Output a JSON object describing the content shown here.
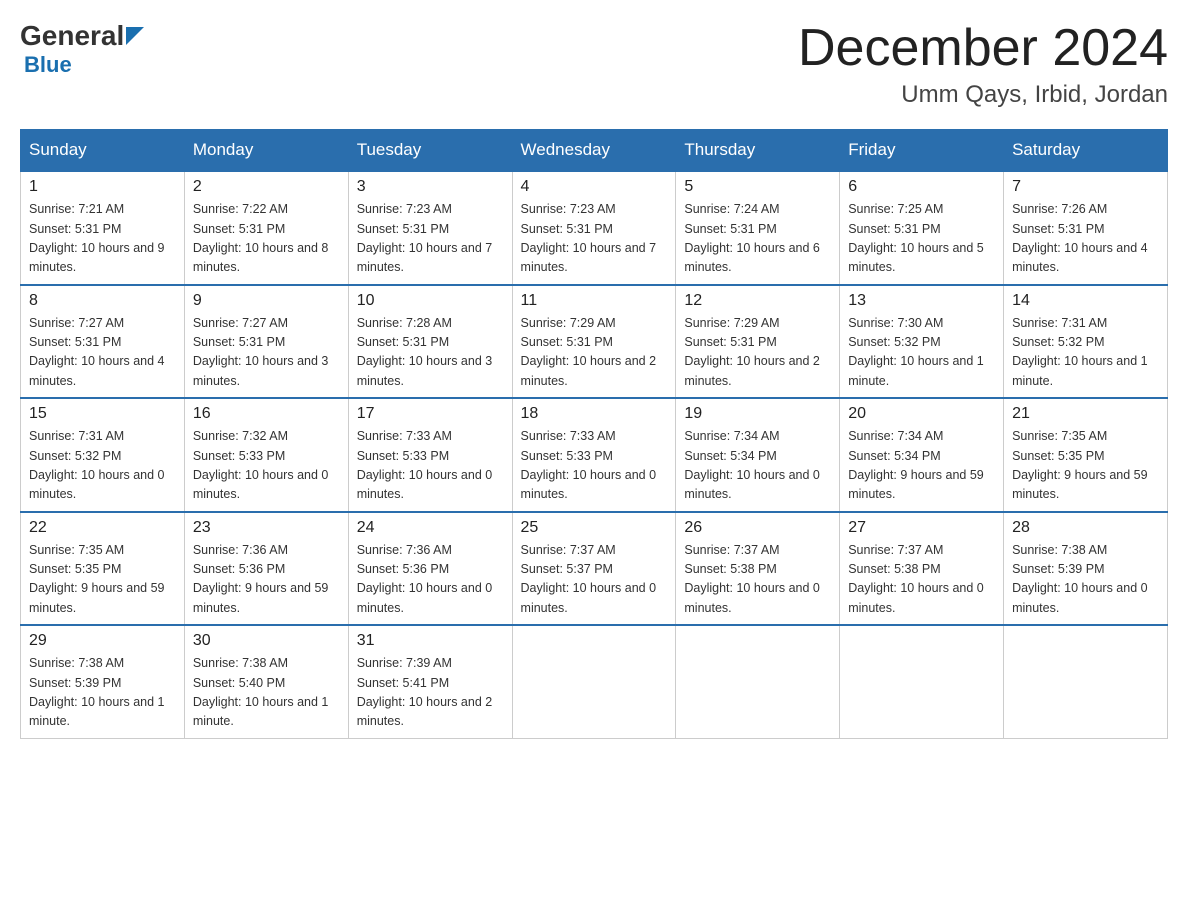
{
  "header": {
    "logo_general": "General",
    "logo_blue": "Blue",
    "month_title": "December 2024",
    "location": "Umm Qays, Irbid, Jordan"
  },
  "days_of_week": [
    "Sunday",
    "Monday",
    "Tuesday",
    "Wednesday",
    "Thursday",
    "Friday",
    "Saturday"
  ],
  "weeks": [
    [
      {
        "day": "1",
        "sunrise": "7:21 AM",
        "sunset": "5:31 PM",
        "daylight": "10 hours and 9 minutes."
      },
      {
        "day": "2",
        "sunrise": "7:22 AM",
        "sunset": "5:31 PM",
        "daylight": "10 hours and 8 minutes."
      },
      {
        "day": "3",
        "sunrise": "7:23 AM",
        "sunset": "5:31 PM",
        "daylight": "10 hours and 7 minutes."
      },
      {
        "day": "4",
        "sunrise": "7:23 AM",
        "sunset": "5:31 PM",
        "daylight": "10 hours and 7 minutes."
      },
      {
        "day": "5",
        "sunrise": "7:24 AM",
        "sunset": "5:31 PM",
        "daylight": "10 hours and 6 minutes."
      },
      {
        "day": "6",
        "sunrise": "7:25 AM",
        "sunset": "5:31 PM",
        "daylight": "10 hours and 5 minutes."
      },
      {
        "day": "7",
        "sunrise": "7:26 AM",
        "sunset": "5:31 PM",
        "daylight": "10 hours and 4 minutes."
      }
    ],
    [
      {
        "day": "8",
        "sunrise": "7:27 AM",
        "sunset": "5:31 PM",
        "daylight": "10 hours and 4 minutes."
      },
      {
        "day": "9",
        "sunrise": "7:27 AM",
        "sunset": "5:31 PM",
        "daylight": "10 hours and 3 minutes."
      },
      {
        "day": "10",
        "sunrise": "7:28 AM",
        "sunset": "5:31 PM",
        "daylight": "10 hours and 3 minutes."
      },
      {
        "day": "11",
        "sunrise": "7:29 AM",
        "sunset": "5:31 PM",
        "daylight": "10 hours and 2 minutes."
      },
      {
        "day": "12",
        "sunrise": "7:29 AM",
        "sunset": "5:31 PM",
        "daylight": "10 hours and 2 minutes."
      },
      {
        "day": "13",
        "sunrise": "7:30 AM",
        "sunset": "5:32 PM",
        "daylight": "10 hours and 1 minute."
      },
      {
        "day": "14",
        "sunrise": "7:31 AM",
        "sunset": "5:32 PM",
        "daylight": "10 hours and 1 minute."
      }
    ],
    [
      {
        "day": "15",
        "sunrise": "7:31 AM",
        "sunset": "5:32 PM",
        "daylight": "10 hours and 0 minutes."
      },
      {
        "day": "16",
        "sunrise": "7:32 AM",
        "sunset": "5:33 PM",
        "daylight": "10 hours and 0 minutes."
      },
      {
        "day": "17",
        "sunrise": "7:33 AM",
        "sunset": "5:33 PM",
        "daylight": "10 hours and 0 minutes."
      },
      {
        "day": "18",
        "sunrise": "7:33 AM",
        "sunset": "5:33 PM",
        "daylight": "10 hours and 0 minutes."
      },
      {
        "day": "19",
        "sunrise": "7:34 AM",
        "sunset": "5:34 PM",
        "daylight": "10 hours and 0 minutes."
      },
      {
        "day": "20",
        "sunrise": "7:34 AM",
        "sunset": "5:34 PM",
        "daylight": "9 hours and 59 minutes."
      },
      {
        "day": "21",
        "sunrise": "7:35 AM",
        "sunset": "5:35 PM",
        "daylight": "9 hours and 59 minutes."
      }
    ],
    [
      {
        "day": "22",
        "sunrise": "7:35 AM",
        "sunset": "5:35 PM",
        "daylight": "9 hours and 59 minutes."
      },
      {
        "day": "23",
        "sunrise": "7:36 AM",
        "sunset": "5:36 PM",
        "daylight": "9 hours and 59 minutes."
      },
      {
        "day": "24",
        "sunrise": "7:36 AM",
        "sunset": "5:36 PM",
        "daylight": "10 hours and 0 minutes."
      },
      {
        "day": "25",
        "sunrise": "7:37 AM",
        "sunset": "5:37 PM",
        "daylight": "10 hours and 0 minutes."
      },
      {
        "day": "26",
        "sunrise": "7:37 AM",
        "sunset": "5:38 PM",
        "daylight": "10 hours and 0 minutes."
      },
      {
        "day": "27",
        "sunrise": "7:37 AM",
        "sunset": "5:38 PM",
        "daylight": "10 hours and 0 minutes."
      },
      {
        "day": "28",
        "sunrise": "7:38 AM",
        "sunset": "5:39 PM",
        "daylight": "10 hours and 0 minutes."
      }
    ],
    [
      {
        "day": "29",
        "sunrise": "7:38 AM",
        "sunset": "5:39 PM",
        "daylight": "10 hours and 1 minute."
      },
      {
        "day": "30",
        "sunrise": "7:38 AM",
        "sunset": "5:40 PM",
        "daylight": "10 hours and 1 minute."
      },
      {
        "day": "31",
        "sunrise": "7:39 AM",
        "sunset": "5:41 PM",
        "daylight": "10 hours and 2 minutes."
      },
      null,
      null,
      null,
      null
    ]
  ]
}
